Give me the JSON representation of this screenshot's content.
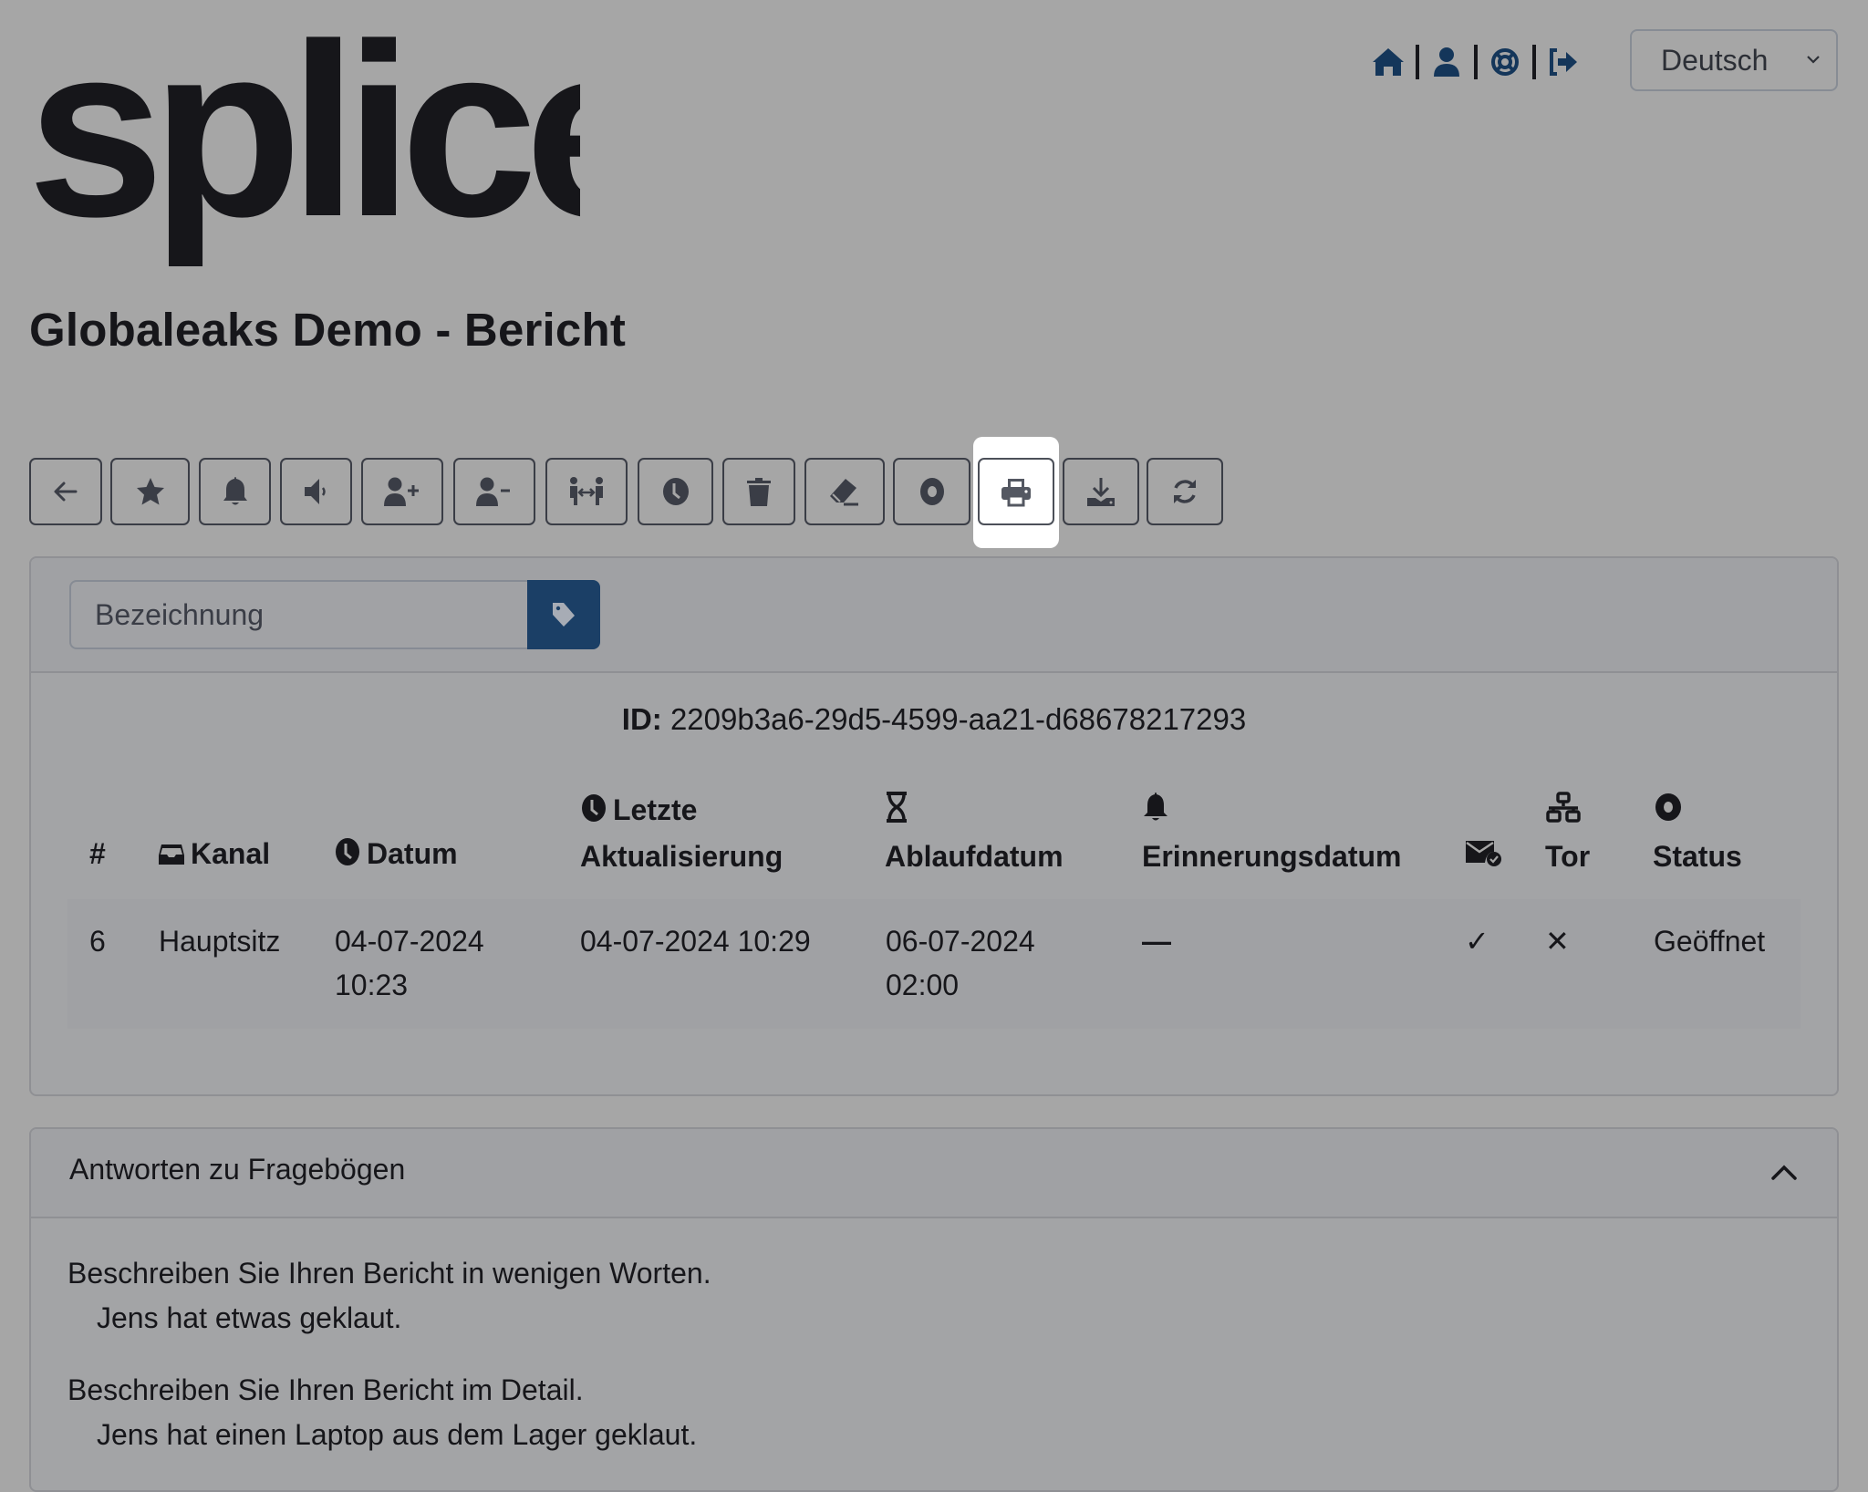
{
  "brand": {
    "logo_text": "splice"
  },
  "topnav": {
    "items": [
      {
        "icon": "home-icon",
        "label": "Startseite"
      },
      {
        "icon": "user-icon",
        "label": "Profil"
      },
      {
        "icon": "support-icon",
        "label": "Hilfe"
      },
      {
        "icon": "logout-icon",
        "label": "Abmelden"
      }
    ],
    "language": {
      "selected": "Deutsch"
    }
  },
  "page": {
    "title": "Globaleaks Demo - Bericht"
  },
  "toolbar": {
    "buttons": [
      {
        "name": "back",
        "icon": "arrow-left-icon"
      },
      {
        "name": "important",
        "icon": "star-icon"
      },
      {
        "name": "reminder",
        "icon": "bell-icon"
      },
      {
        "name": "silence",
        "icon": "volume-icon"
      },
      {
        "name": "grant-access",
        "icon": "user-plus-icon"
      },
      {
        "name": "revoke-access",
        "icon": "user-minus-icon"
      },
      {
        "name": "transfer",
        "icon": "people-arrows-icon"
      },
      {
        "name": "postpone",
        "icon": "clock-icon"
      },
      {
        "name": "delete",
        "icon": "trash-icon"
      },
      {
        "name": "redact",
        "icon": "eraser-icon"
      },
      {
        "name": "status",
        "icon": "circle-dot-icon"
      },
      {
        "name": "print",
        "icon": "print-icon",
        "active": true
      },
      {
        "name": "download",
        "icon": "download-icon"
      },
      {
        "name": "reload",
        "icon": "refresh-icon"
      }
    ]
  },
  "labeling": {
    "placeholder": "Bezeichnung",
    "value": "",
    "button_icon": "tag-icon"
  },
  "report": {
    "id_label": "ID:",
    "id_value": "2209b3a6-29d5-4599-aa21-d68678217293",
    "columns": {
      "number": "#",
      "channel": "Kanal",
      "date": "Datum",
      "last_update_line1": "Letzte",
      "last_update_line2": "Aktualisierung",
      "expiration": "Ablaufdatum",
      "reminder": "Erinnerungsdatum",
      "notification": "",
      "tor": "Tor",
      "status": "Status"
    },
    "row": {
      "number": "6",
      "channel": "Hauptsitz",
      "date_line1": "04-07-2024",
      "date_line2": "10:23",
      "last_update": "04-07-2024 10:29",
      "expiration_line1": "06-07-2024",
      "expiration_line2": "02:00",
      "reminder": "—",
      "notification": "✓",
      "tor": "✕",
      "status": "Geöffnet"
    }
  },
  "questionnaire": {
    "title": "Antworten zu Fragebögen",
    "items": [
      {
        "question": "Beschreiben Sie Ihren Bericht in wenigen Worten.",
        "answer": "Jens hat etwas geklaut."
      },
      {
        "question": "Beschreiben Sie Ihren Bericht im Detail.",
        "answer": "Jens hat einen Laptop aus dem Lager geklaut."
      }
    ]
  },
  "colors": {
    "background": "#a6a6a6",
    "accent": "#1b3f66",
    "nav_icon": "#14365a",
    "text": "#16161a"
  }
}
